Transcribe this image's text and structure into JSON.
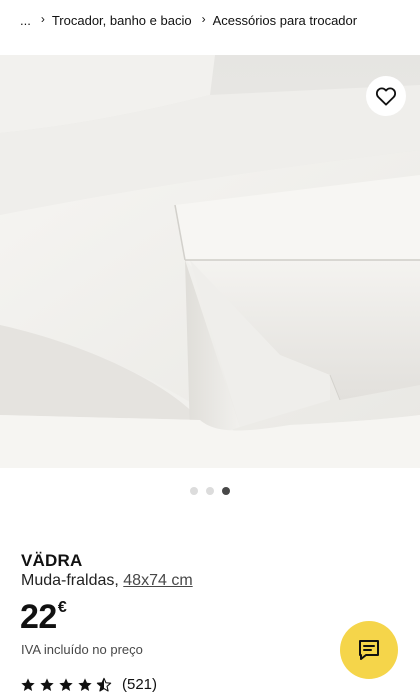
{
  "breadcrumb": {
    "ellipsis": "...",
    "items": [
      "Trocador, banho e bacio",
      "Acessórios para trocador"
    ],
    "separator": "›"
  },
  "gallery": {
    "image_alt": "",
    "dots_total": 3,
    "active_index": 2
  },
  "product": {
    "name": "VÄDRA",
    "type": "Muda-fraldas,",
    "size": "48x74 cm",
    "price_int": "22",
    "currency": "€",
    "vat_note": "IVA incluído no preço"
  },
  "rating": {
    "value": 4.5,
    "max": 5,
    "count": "(521)"
  },
  "icons": {
    "favourite": "heart-icon",
    "chat": "chat-icon",
    "star": "star-icon"
  },
  "colors": {
    "chat_button": "#f5d54a",
    "active_dot": "#484848",
    "inactive_dot": "#dcdcdc"
  }
}
